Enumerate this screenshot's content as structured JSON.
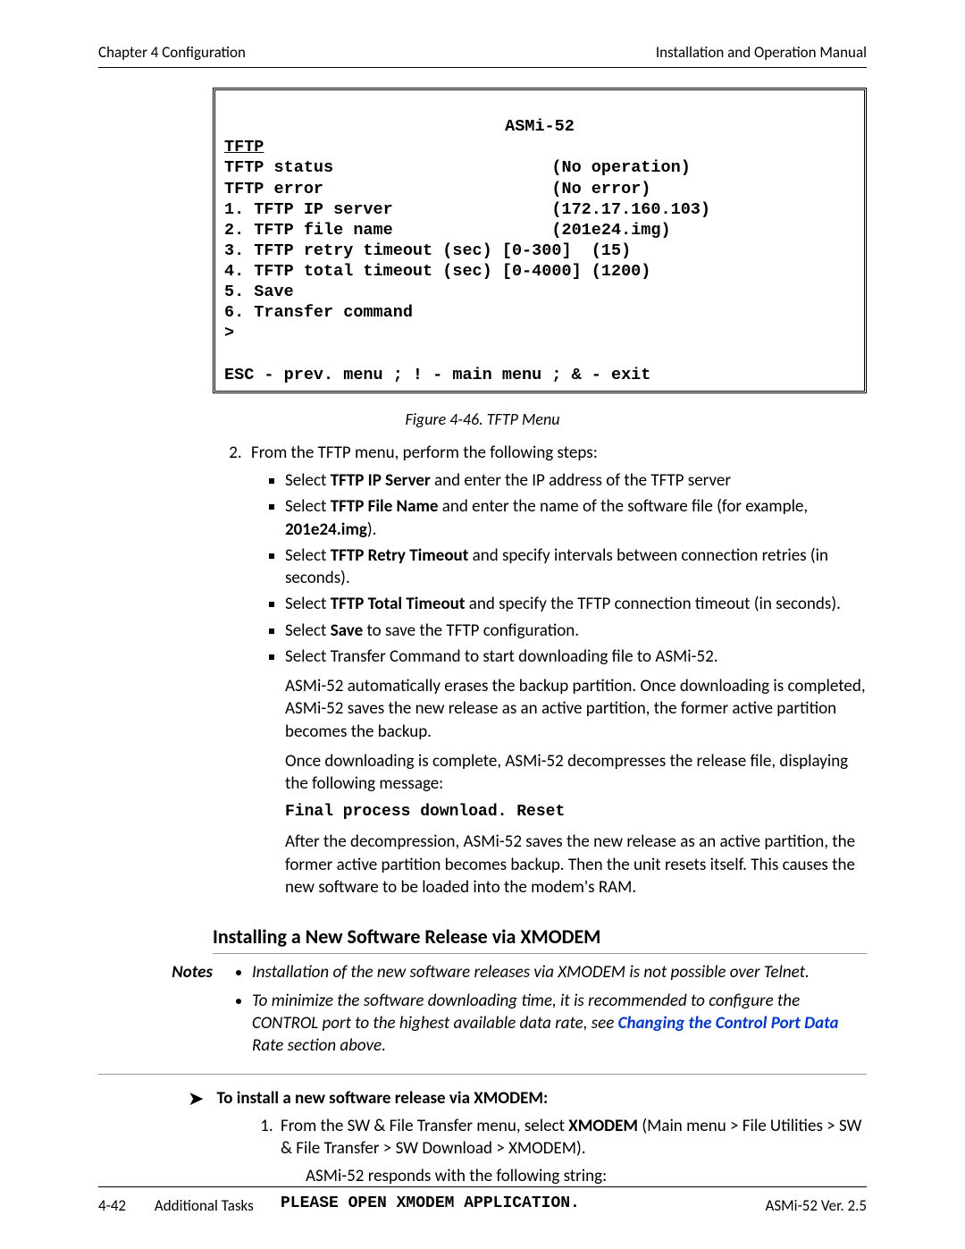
{
  "header": {
    "left": "Chapter 4  Configuration",
    "right": "Installation and Operation Manual"
  },
  "terminal": {
    "title": "ASMi-52",
    "heading": "TFTP",
    "status_lbl": "TFTP status",
    "status_val": "(No operation)",
    "error_lbl": "TFTP error",
    "error_val": "(No error)",
    "l1": "1. TFTP IP server",
    "l1v": "(172.17.160.103)",
    "l2": "2. TFTP file name",
    "l2v": "(201e24.img)",
    "l3": "3. TFTP retry timeout (sec) [0-300]  (15)",
    "l4": "4. TFTP total timeout (sec) [0-4000] (1200)",
    "l5": "5. Save",
    "l6": "6. Transfer command",
    "prompt": ">",
    "nav": "ESC - prev. menu ; ! - main menu ; & - exit"
  },
  "figcap": "Figure 4-46.  TFTP Menu",
  "step2_intro": "From the TFTP menu, perform the following steps:",
  "bullets": {
    "b1a": "Select ",
    "b1b": "TFTP IP Server",
    "b1c": " and enter the IP address of the TFTP server",
    "b2a": "Select ",
    "b2b": "TFTP File Name",
    "b2c": " and enter the name of the software file (for example, ",
    "b2d": "201e24.img",
    "b2e": ").",
    "b3a": "Select ",
    "b3b": "TFTP Retry Timeout",
    "b3c": " and specify intervals between connection retries (in seconds).",
    "b4a": "Select ",
    "b4b": "TFTP Total Timeout",
    "b4c": " and specify the TFTP connection timeout (in seconds).",
    "b5a": "Select ",
    "b5b": "Save",
    "b5c": " to save the TFTP configuration.",
    "b6": "Select Transfer Command to start downloading file to ASMi-52."
  },
  "p1": "ASMi-52 automatically erases the backup partition. Once downloading is completed, ASMi-52 saves the new release as an active partition, the former active partition becomes the backup.",
  "p2": "Once downloading is complete, ASMi-52 decompresses the release file, displaying the following message:",
  "msg1": "Final process download. Reset",
  "p3": "After the decompression, ASMi-52 saves the new release as an active partition, the former active partition becomes backup. Then the unit resets itself. This causes the new software to be loaded into the modem's RAM.",
  "h3": "Installing a New Software Release via XMODEM",
  "notes_label": "Notes",
  "note1": "Installation of the new software releases via XMODEM is not possible over Telnet.",
  "note2a": "To minimize the software downloading time, it is recommended to configure the CONTROL port to the highest available data rate, see ",
  "note2link": "Changing the Control Port Data",
  "note2b": " Rate section above.",
  "proc_title": "To install a new software release via XMODEM:",
  "step1a": "From the SW & File Transfer menu, select ",
  "step1b": "XMODEM",
  "step1c": " (Main menu > File Utilities > SW & File Transfer > SW Download > XMODEM).",
  "resp": "ASMi-52 responds with the following string:",
  "msg2": "PLEASE OPEN XMODEM APPLICATION.",
  "footer": {
    "page": "4-42",
    "section": "Additional Tasks",
    "right": "ASMi-52 Ver. 2.5"
  }
}
